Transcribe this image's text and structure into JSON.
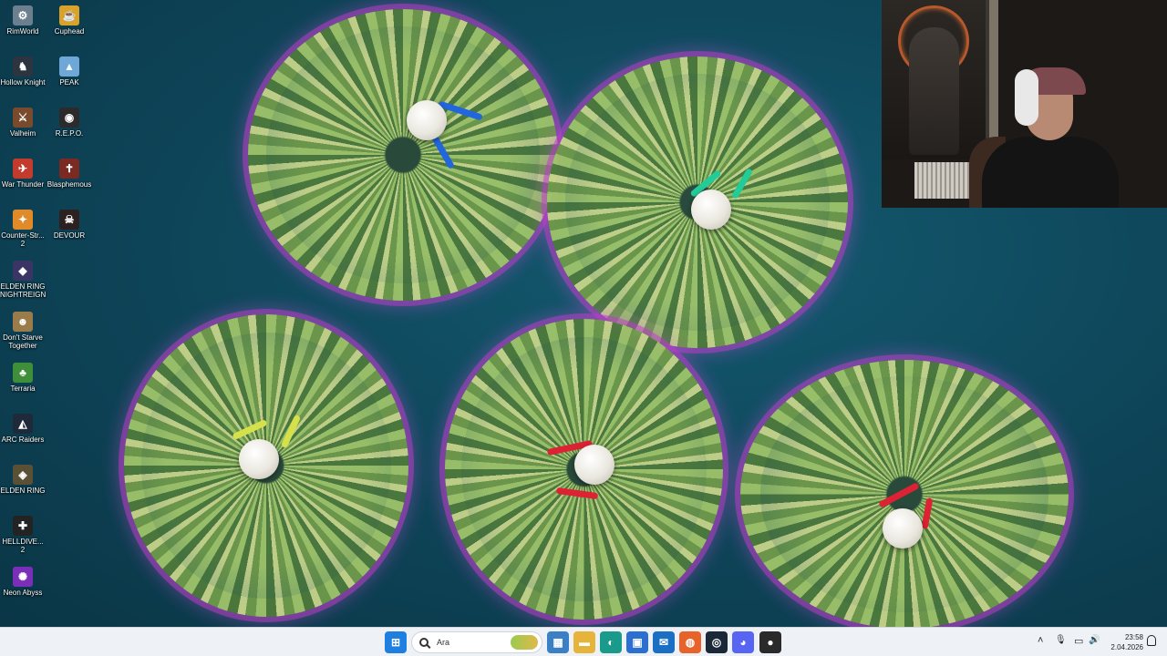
{
  "desktop": {
    "icons": [
      {
        "label": "RimWorld",
        "icon": "rimworld-icon",
        "color": "#6b7f8f",
        "glyph": "⚙"
      },
      {
        "label": "Cuphead",
        "icon": "cuphead-icon",
        "color": "#d9a22b",
        "glyph": "☕"
      },
      {
        "label": "Hollow Knight",
        "icon": "hollow-knight-icon",
        "color": "#2c3440",
        "glyph": "♞"
      },
      {
        "label": "PEAK",
        "icon": "peak-icon",
        "color": "#6fa7d8",
        "glyph": "▲"
      },
      {
        "label": "Valheim",
        "icon": "valheim-icon",
        "color": "#7a4a2c",
        "glyph": "⚔"
      },
      {
        "label": "R.E.P.O.",
        "icon": "repo-icon",
        "color": "#2b2b2b",
        "glyph": "◉"
      },
      {
        "label": "War Thunder",
        "icon": "war-thunder-icon",
        "color": "#c23b2c",
        "glyph": "✈"
      },
      {
        "label": "Blasphemous",
        "icon": "blasphemous-icon",
        "color": "#7a2a22",
        "glyph": "✝"
      },
      {
        "label": "Counter-Str... 2",
        "icon": "counter-strike-icon",
        "color": "#e08a2a",
        "glyph": "✦"
      },
      {
        "label": "DEVOUR",
        "icon": "devour-icon",
        "color": "#2d2020",
        "glyph": "☠"
      },
      {
        "label": "ELDEN RING NIGHTREIGN",
        "icon": "elden-ring-nightreign-icon",
        "color": "#3b3566",
        "glyph": "◆"
      },
      {
        "label": "Don't Starve Together",
        "icon": "dont-starve-icon",
        "color": "#9a7b4a",
        "glyph": "☻"
      },
      {
        "label": "Terraria",
        "icon": "terraria-icon",
        "color": "#3f8f3a",
        "glyph": "♣"
      },
      {
        "label": "ARC Raiders",
        "icon": "arc-raiders-icon",
        "color": "#1e2a3a",
        "glyph": "◭"
      },
      {
        "label": "ELDEN RING",
        "icon": "elden-ring-icon",
        "color": "#5a5036",
        "glyph": "◈"
      },
      {
        "label": "HELLDIVE... 2",
        "icon": "helldivers-icon",
        "color": "#232323",
        "glyph": "✚"
      },
      {
        "label": "Neon Abyss",
        "icon": "neon-abyss-icon",
        "color": "#7a2fb8",
        "glyph": "✺"
      }
    ]
  },
  "taskbar": {
    "search_placeholder": "Ara",
    "apps": [
      {
        "name": "start-button",
        "icon": "windows-start-icon",
        "color": "#1f7fe0",
        "glyph": "⊞"
      },
      {
        "name": "widgets-button",
        "icon": "widgets-icon",
        "color": "#3b7fc4",
        "glyph": "▦"
      },
      {
        "name": "file-explorer-button",
        "icon": "folder-icon",
        "color": "#e6b43a",
        "glyph": "▬"
      },
      {
        "name": "edge-button",
        "icon": "edge-icon",
        "color": "#1a9a8a",
        "glyph": "◐"
      },
      {
        "name": "store-button",
        "icon": "store-icon",
        "color": "#2d6fd1",
        "glyph": "▣"
      },
      {
        "name": "outlook-button",
        "icon": "outlook-icon",
        "color": "#1a6fc4",
        "glyph": "✉"
      },
      {
        "name": "firefox-button",
        "icon": "firefox-icon",
        "color": "#e8632a",
        "glyph": "◍"
      },
      {
        "name": "steam-button",
        "icon": "steam-icon",
        "color": "#1b2838",
        "glyph": "◎"
      },
      {
        "name": "discord-button",
        "icon": "discord-icon",
        "color": "#5865f2",
        "glyph": "◕"
      },
      {
        "name": "obs-button",
        "icon": "obs-icon",
        "color": "#2a2a2a",
        "glyph": "●"
      }
    ],
    "tray": {
      "chevron": "˄",
      "mic": "🎙",
      "network": "▭",
      "volume": "🔊"
    },
    "clock": {
      "time": "23:58",
      "date": "2.04.2026"
    }
  },
  "colors": {
    "taskbar_bg": "#eef2f6",
    "wallpaper_water": "#0e4458"
  }
}
